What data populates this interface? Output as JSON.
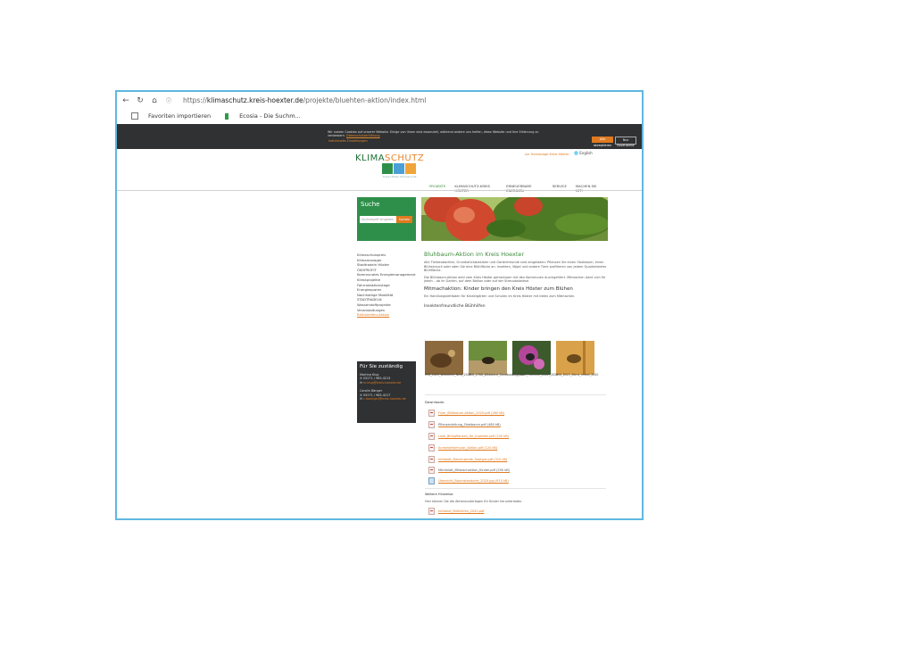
{
  "browser": {
    "url_prefix": "https://",
    "url_host": "klimaschutz.kreis-hoexter.de",
    "url_path": "/projekte/bluehten-aktion/index.html",
    "favorites": [
      "Favoriten importieren",
      "Ecosia - Die Suchm..."
    ]
  },
  "cookie_banner": {
    "text": "Wir nutzen Cookies auf unserer Website. Einige von ihnen sind essenziell, während andere uns helfen, diese Website und Ihre Erfahrung zu verbessern.",
    "privacy_link": "Datenschutzerklärung",
    "settings_link": "Individuelle Einstellungen",
    "accept_label": "Alle akzeptieren",
    "essential_label": "Nur Essenzielle"
  },
  "header": {
    "logo_main": "KLIMA",
    "logo_accent": "SCHUTZ",
    "logo_sub": "Kreis Höxter Klimaschutz",
    "top_link": "zur Homepage Kreis Höxter",
    "language": "English",
    "nav": [
      "PROJEKTE",
      "KLIMASCHUTZ-KREIS HÖXTER",
      "ERNEUERBARE ENERGIEN",
      "SERVICE",
      "MACHEN SIE MIT!"
    ]
  },
  "sidebar": {
    "search_title": "Suche",
    "search_placeholder": "Suchbegriff eingeben",
    "search_button": "Suchen",
    "items": [
      "Klimaschutzpreis",
      "Klimamanager",
      "Stadtradeln Höxter",
      "ÖKOPROFIT",
      "Kommunales Energiemanagement",
      "Klimaprojekte",
      "Fahrradaktionstage",
      "Energiesparen",
      "Nachhaltige Mobilität",
      "STADTRADELN",
      "Wasserstoffprojekte",
      "Veranstaltungen",
      "Blühstreifen-Aktion"
    ],
    "contact_title": "Für Sie zuständig",
    "contacts": [
      {
        "name": "Martina Klug",
        "phone": "05271 / 965-4213",
        "email": "m.klug@kreis-hoexter.de"
      },
      {
        "name": "Carolin Bänger",
        "phone": "05271 / 965-4217",
        "email": "c.baenger@kreis-hoexter.de"
      }
    ]
  },
  "content": {
    "title": "Bluhbaum-Aktion im Kreis Hoexter",
    "intro": "Alle Tierbeobachter, Grundstücksbesitzer und Gartenfreunde sind eingeladen: Pflanzen Sie einen Obstbaum, einen Blühstrauch oder säen Sie eine Blühfläche an. Insekten, Vögel und andere Tiere profitieren von jedem Quadratmeter Blühfläche.",
    "intro2": "Die Blühbaum-Aktion wird vom Kreis Höxter gemeinsam mit den Kommunen durchgeführt. Mitmachen lohnt sich für jeden – ob im Garten, auf dem Balkon oder auf der Streuobstwiese.",
    "subtitle": "Mitmachaktion: Kinder bringen den Kreis Höxter zum Blühen",
    "sub_text": "Ein Handlungsleitfaden für Kindergärten und Schulen im Kreis Höxter mit Ideen zum Mitmachen.",
    "gallery_title": "Insektenfreundliche Blühhilfen",
    "photos": [
      {
        "caption": "IMG_0420_Wildbiene_Nest_2020"
      },
      {
        "caption": "IMG_2788_Wildbiene_Sandboden_2020"
      },
      {
        "caption": "IMG_0889_Hummel_Distel_2020"
      },
      {
        "caption": "IMG_8921_Biene_Insekt_2020"
      }
    ],
    "downloads_title": "Downloads:",
    "downloads": [
      {
        "label": "Flyer_Blühbaum-Aktion_2020.pdf (260 kB)",
        "linked": true,
        "type": "pdf"
      },
      {
        "label": "Pflanzanleitung_Obstbaum.pdf (480 kB)",
        "linked": false,
        "type": "pdf"
      },
      {
        "label": "Liste_Blühpflanzen_für_Insekten.pdf (220 kB)",
        "linked": true,
        "type": "pdf"
      },
      {
        "label": "Anmeldeformular_Aktion.pdf (120 kB)",
        "linked": true,
        "type": "pdf"
      },
      {
        "label": "Infoblatt_Bienenweide_Saatgut.pdf (310 kB)",
        "linked": true,
        "type": "pdf"
      },
      {
        "label": "Merkblatt_Mitmachaktion_Kinder.pdf (290 kB)",
        "linked": false,
        "type": "pdf"
      },
      {
        "label": "Übersicht_Baumstandorte_2020.jpg (910 kB)",
        "linked": true,
        "type": "image"
      }
    ],
    "notes_title": "Weitere Hinweise:",
    "notes_text": "Hier können Sie die Aktionsunterlagen für Kinder herunterladen.",
    "notes_download": "Infobrief_Blühhilfen_2020.pdf"
  },
  "colors": {
    "green": "#3d8b3d",
    "orange": "#e07a1f",
    "dark": "#2f3133"
  }
}
